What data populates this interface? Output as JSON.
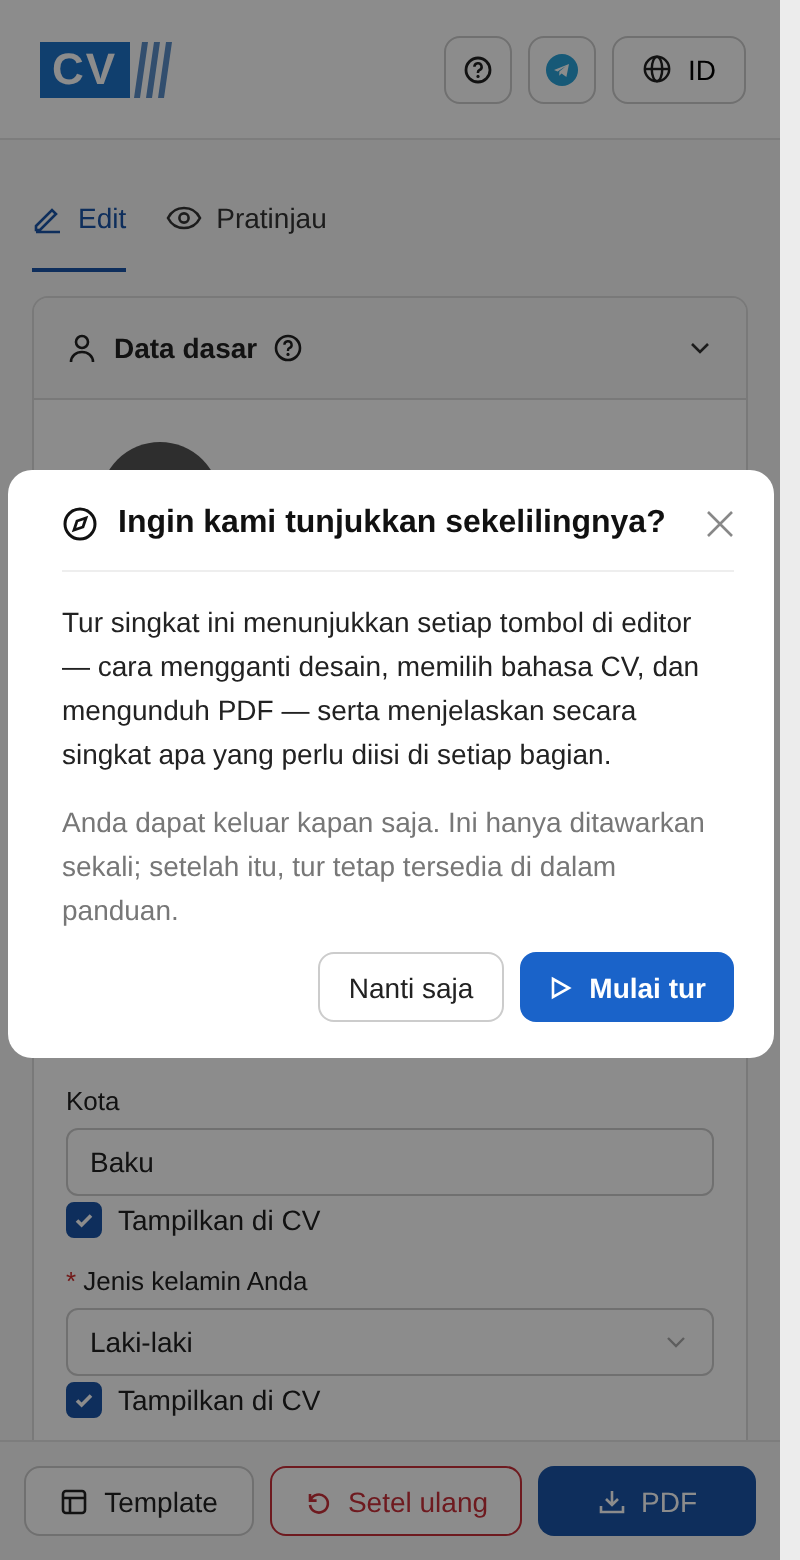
{
  "header": {
    "logo": "CV",
    "language": "ID"
  },
  "tabs": [
    {
      "label": "Edit",
      "selected": true
    },
    {
      "label": "Pratinjau",
      "selected": false
    }
  ],
  "required_marker": "*",
  "section": {
    "title": "Data dasar",
    "expanded": true
  },
  "fields": [
    {
      "label": "Kota",
      "required": false,
      "kind": "text",
      "value": "Baku",
      "option": {
        "label": "Tampilkan di CV",
        "checked": true
      }
    },
    {
      "label": "Jenis kelamin Anda",
      "required": true,
      "kind": "select",
      "value": "Laki-laki",
      "option": {
        "label": "Tampilkan di CV",
        "checked": true
      }
    }
  ],
  "footer": [
    {
      "label": "Template",
      "kind": "template"
    },
    {
      "label": "Setel ulang",
      "kind": "reset"
    },
    {
      "label": "PDF",
      "kind": "pdf"
    }
  ],
  "dialog": {
    "title": "Ingin kami tunjukkan sekelilingnya?",
    "body": "Tur singkat ini menunjukkan setiap tombol di editor — cara mengganti desain, memilih bahasa CV, dan mengunduh PDF — serta menjelaskan secara singkat apa yang perlu diisi di setiap bagian.",
    "note": "Anda dapat keluar kapan saja. Ini hanya ditawarkan sekali; setelah itu, tur tetap tersedia di dalam panduan.",
    "buttons": [
      {
        "label": "Nanti saja",
        "kind": "secondary"
      },
      {
        "label": "Mulai tur",
        "kind": "primary"
      }
    ]
  }
}
